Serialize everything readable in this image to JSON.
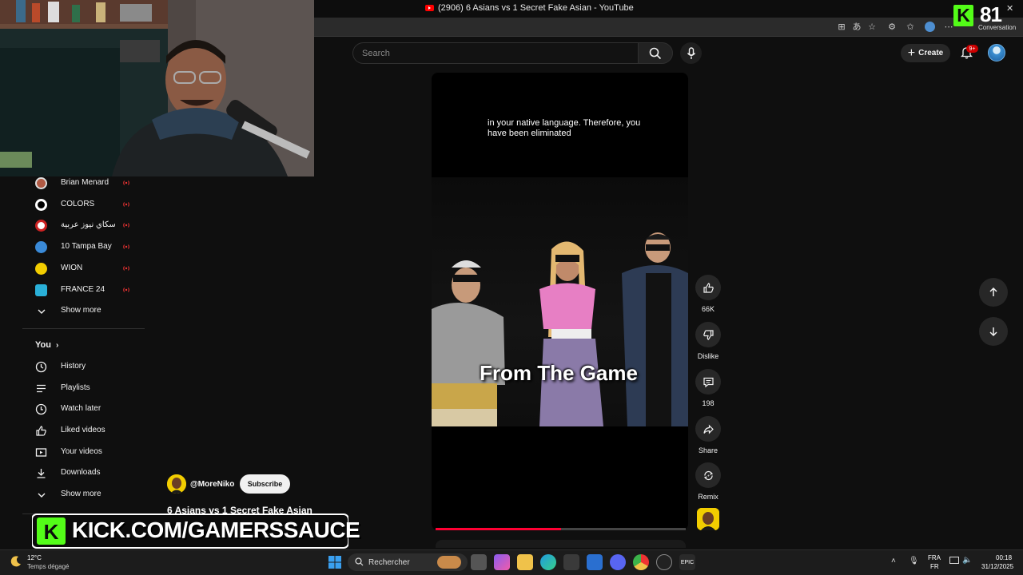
{
  "window": {
    "title": "(2906) 6 Asians vs 1 Secret Fake Asian - YouTube"
  },
  "kick_overlay": {
    "viewer_count": "81",
    "label": "Conversation",
    "banner_text": "KICK.COM/GAMERSSAUCE",
    "accent": "#53fc18"
  },
  "header": {
    "search_placeholder": "Search",
    "create_label": "Create",
    "notifications_badge": "9+"
  },
  "sidebar": {
    "subscriptions": [
      {
        "label": "Brian Menard",
        "icon": "channel-avatar",
        "live": true
      },
      {
        "label": "COLORS",
        "icon": "channel-avatar",
        "live": true
      },
      {
        "label": "سكاي نيوز عربية",
        "icon": "channel-avatar",
        "live": true
      },
      {
        "label": "10 Tampa Bay",
        "icon": "channel-avatar",
        "live": true
      },
      {
        "label": "WION",
        "icon": "channel-avatar",
        "live": true
      },
      {
        "label": "FRANCE 24",
        "icon": "channel-avatar",
        "live": true
      }
    ],
    "show_more_1": "Show more",
    "you_heading": "You",
    "you_items": [
      {
        "label": "History",
        "icon": "history-icon"
      },
      {
        "label": "Playlists",
        "icon": "playlists-icon"
      },
      {
        "label": "Watch later",
        "icon": "watch-later-icon"
      },
      {
        "label": "Liked videos",
        "icon": "like-icon"
      },
      {
        "label": "Your videos",
        "icon": "your-videos-icon"
      },
      {
        "label": "Downloads",
        "icon": "download-icon"
      }
    ],
    "show_more_2": "Show more"
  },
  "short": {
    "caption": "in your native language. Therefore, you have been eliminated",
    "subtitle": "From The Game",
    "channel": "@MoreNiko",
    "subscribe_label": "Subscribe",
    "title": "6 Asians vs 1 Secret Fake Asian",
    "progress": 0.5,
    "progress_color": "#ff0033"
  },
  "actions": {
    "like_count": "66K",
    "dislike_label": "Dislike",
    "comment_count": "198",
    "share_label": "Share",
    "remix_label": "Remix"
  },
  "taskbar": {
    "temperature": "12°C",
    "weather": "Temps dégagé",
    "search_label": "Rechercher",
    "lang_top": "FRA",
    "lang_bottom": "FR",
    "time": "00:18",
    "date": "31/12/2025"
  }
}
